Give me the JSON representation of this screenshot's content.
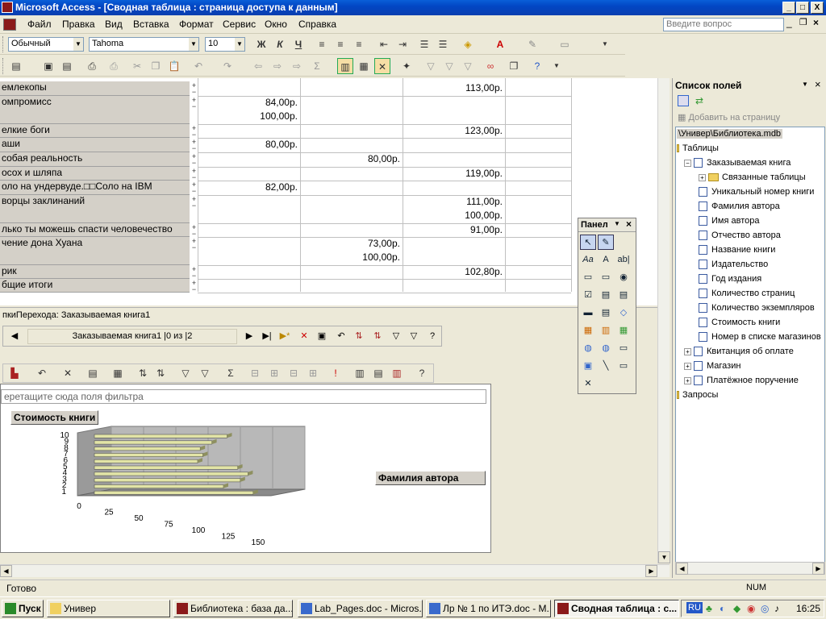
{
  "window": {
    "title": "Microsoft Access - [Сводная таблица : страница доступа к данным]",
    "controls": [
      "_",
      "□",
      "X"
    ]
  },
  "menu": {
    "items": [
      "Файл",
      "Правка",
      "Вид",
      "Вставка",
      "Формат",
      "Сервис",
      "Окно",
      "Справка"
    ],
    "ask_placeholder": "Введите вопрос"
  },
  "format_toolbar": {
    "style": "Обычный",
    "font": "Tahoma",
    "size": "10",
    "bold": "Ж",
    "italic": "К",
    "underline": "Ч"
  },
  "pivot_rows": [
    {
      "label": "емлекопы",
      "c1": "",
      "c2": "",
      "c3": "113,00р."
    },
    {
      "label": "омпромисс",
      "c1": "84,00р.",
      "c1b": "100,00р.",
      "c2": "",
      "c3": ""
    },
    {
      "label": "елкие боги",
      "c1": "",
      "c2": "",
      "c3": "123,00р."
    },
    {
      "label": "аши",
      "c1": "80,00р.",
      "c2": "",
      "c3": ""
    },
    {
      "label": "собая реальность",
      "c1": "",
      "c2": "80,00р.",
      "c3": ""
    },
    {
      "label": "осох и шляпа",
      "c1": "",
      "c2": "",
      "c3": "119,00р."
    },
    {
      "label": "оло на ундервуде.□□Соло на IBM",
      "c1": "82,00р.",
      "c2": "",
      "c3": ""
    },
    {
      "label": "ворцы заклинаний",
      "c1": "",
      "c2": "",
      "c3": "111,00р.",
      "c3b": "100,00р."
    },
    {
      "label": "лько ты можешь спасти человечество",
      "c1": "",
      "c2": "",
      "c3": "91,00р."
    },
    {
      "label": "чение дона Хуана",
      "c1": "",
      "c2": "73,00р.",
      "c2b": "100,00р.",
      "c3": ""
    },
    {
      "label": "рик",
      "c1": "",
      "c2": "",
      "c3": "102,80р."
    },
    {
      "label": "бщие итоги",
      "c1": "",
      "c2": "",
      "c3": ""
    }
  ],
  "navigation": {
    "caption": "пкиПерехода: Заказываемая книга1",
    "record_label": "Заказываемая книга1 |0 из |2"
  },
  "chart": {
    "filter_zone": "еретащите сюда поля фильтра",
    "data_field": "Стоимость книги",
    "series_field": "Фамилия автора"
  },
  "chart_data": {
    "type": "bar",
    "orientation": "horizontal-3d",
    "categories": [
      "1",
      "2",
      "3",
      "4",
      "5",
      "6",
      "7",
      "8",
      "9",
      "10"
    ],
    "values": [
      123,
      100,
      113,
      119,
      111,
      80,
      84,
      82,
      91,
      102.8
    ],
    "xticks": [
      "0",
      "25",
      "50",
      "75",
      "100",
      "125",
      "150"
    ],
    "xlim": [
      0,
      150
    ],
    "grid": true
  },
  "panel": {
    "title": "Панел"
  },
  "field_list": {
    "title": "Список полей",
    "add_to_page": "Добавить на страницу",
    "db_path": "\\Универ\\Библиотека.mdb",
    "nodes": [
      {
        "label": "Таблицы",
        "level": 0,
        "kind": "folder"
      },
      {
        "label": "Заказываемая книга",
        "level": 1,
        "kind": "table",
        "box": "−"
      },
      {
        "label": "Связанные таблицы",
        "level": 2,
        "kind": "folder",
        "box": "+"
      },
      {
        "label": "Уникальный номер книги",
        "level": 2,
        "kind": "field"
      },
      {
        "label": "Фамилия автора",
        "level": 2,
        "kind": "field"
      },
      {
        "label": "Имя автора",
        "level": 2,
        "kind": "field"
      },
      {
        "label": "Отчество автора",
        "level": 2,
        "kind": "field"
      },
      {
        "label": "Название книги",
        "level": 2,
        "kind": "field"
      },
      {
        "label": "Издательство",
        "level": 2,
        "kind": "field"
      },
      {
        "label": "Год издания",
        "level": 2,
        "kind": "field"
      },
      {
        "label": "Количество страниц",
        "level": 2,
        "kind": "field"
      },
      {
        "label": "Количество экземпляров",
        "level": 2,
        "kind": "field"
      },
      {
        "label": "Стоимость книги",
        "level": 2,
        "kind": "field"
      },
      {
        "label": "Номер в списке магазинов",
        "level": 2,
        "kind": "field"
      },
      {
        "label": "Квитанция об оплате",
        "level": 1,
        "kind": "table",
        "box": "+"
      },
      {
        "label": "Магазин",
        "level": 1,
        "kind": "table",
        "box": "+"
      },
      {
        "label": "Платёжное поручение",
        "level": 1,
        "kind": "table",
        "box": "+"
      },
      {
        "label": "Запросы",
        "level": 0,
        "kind": "folder"
      }
    ]
  },
  "status": {
    "text": "Готово",
    "num": "NUM"
  },
  "taskbar": {
    "start": "Пуск",
    "tasks": [
      "Универ",
      "Библиотека : база да...",
      "Lab_Pages.doc - Micros...",
      "Лр № 1 по ИТЭ.doc - М...",
      "Сводная таблица : с..."
    ],
    "lang": "RU",
    "clock": "16:25"
  }
}
